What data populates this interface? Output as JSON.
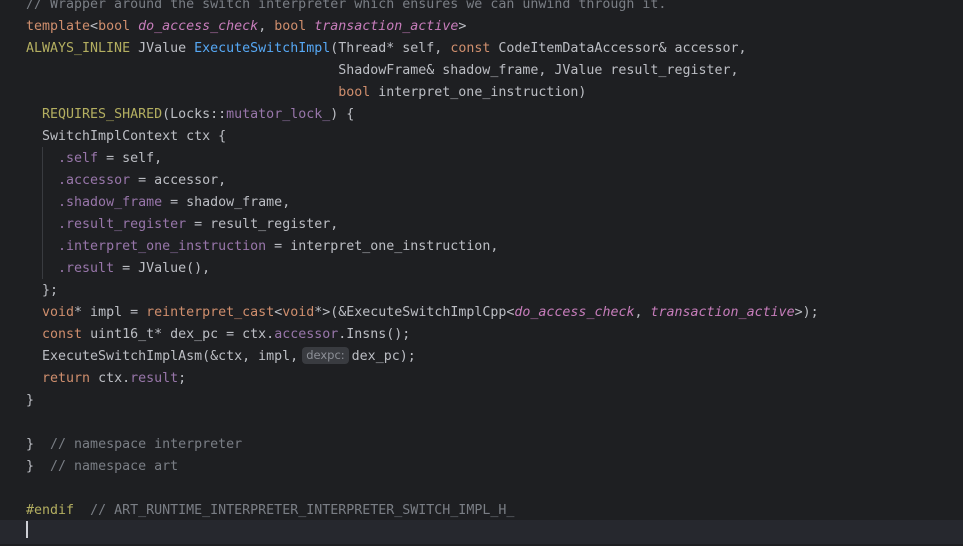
{
  "editor": {
    "lines": [
      "// Wrapper around the switch interpreter which ensures we can unwind through it.",
      "template<bool do_access_check, bool transaction_active>",
      "ALWAYS_INLINE JValue ExecuteSwitchImpl(Thread* self, const CodeItemDataAccessor& accessor,",
      "                                       ShadowFrame& shadow_frame, JValue result_register,",
      "                                       bool interpret_one_instruction)",
      "  REQUIRES_SHARED(Locks::mutator_lock_) {",
      "  SwitchImplContext ctx {",
      "    .self = self,",
      "    .accessor = accessor,",
      "    .shadow_frame = shadow_frame,",
      "    .result_register = result_register,",
      "    .interpret_one_instruction = interpret_one_instruction,",
      "    .result = JValue(),",
      "  };",
      "  void* impl = reinterpret_cast<void*>(&ExecuteSwitchImplCpp<do_access_check, transaction_active>);",
      "  const uint16_t* dex_pc = ctx.accessor.Insns();",
      "  ExecuteSwitchImplAsm(&ctx, impl, dex_pc);",
      "  return ctx.result;",
      "}",
      "",
      "}  // namespace interpreter",
      "}  // namespace art",
      "",
      "#endif  // ART_RUNTIME_INTERPRETER_INTERPRETER_SWITCH_IMPL_H_",
      ""
    ],
    "inlay_hint": "dexpc:",
    "colors": {
      "background": "#1e1f22",
      "current_line": "#26282e",
      "keyword": "#cf8e6d",
      "comment": "#7a7e85",
      "function": "#56a8f5",
      "macro": "#b3ae60",
      "parameter": "#c77dbb",
      "field": "#9876aa",
      "default": "#bcbec4"
    }
  }
}
